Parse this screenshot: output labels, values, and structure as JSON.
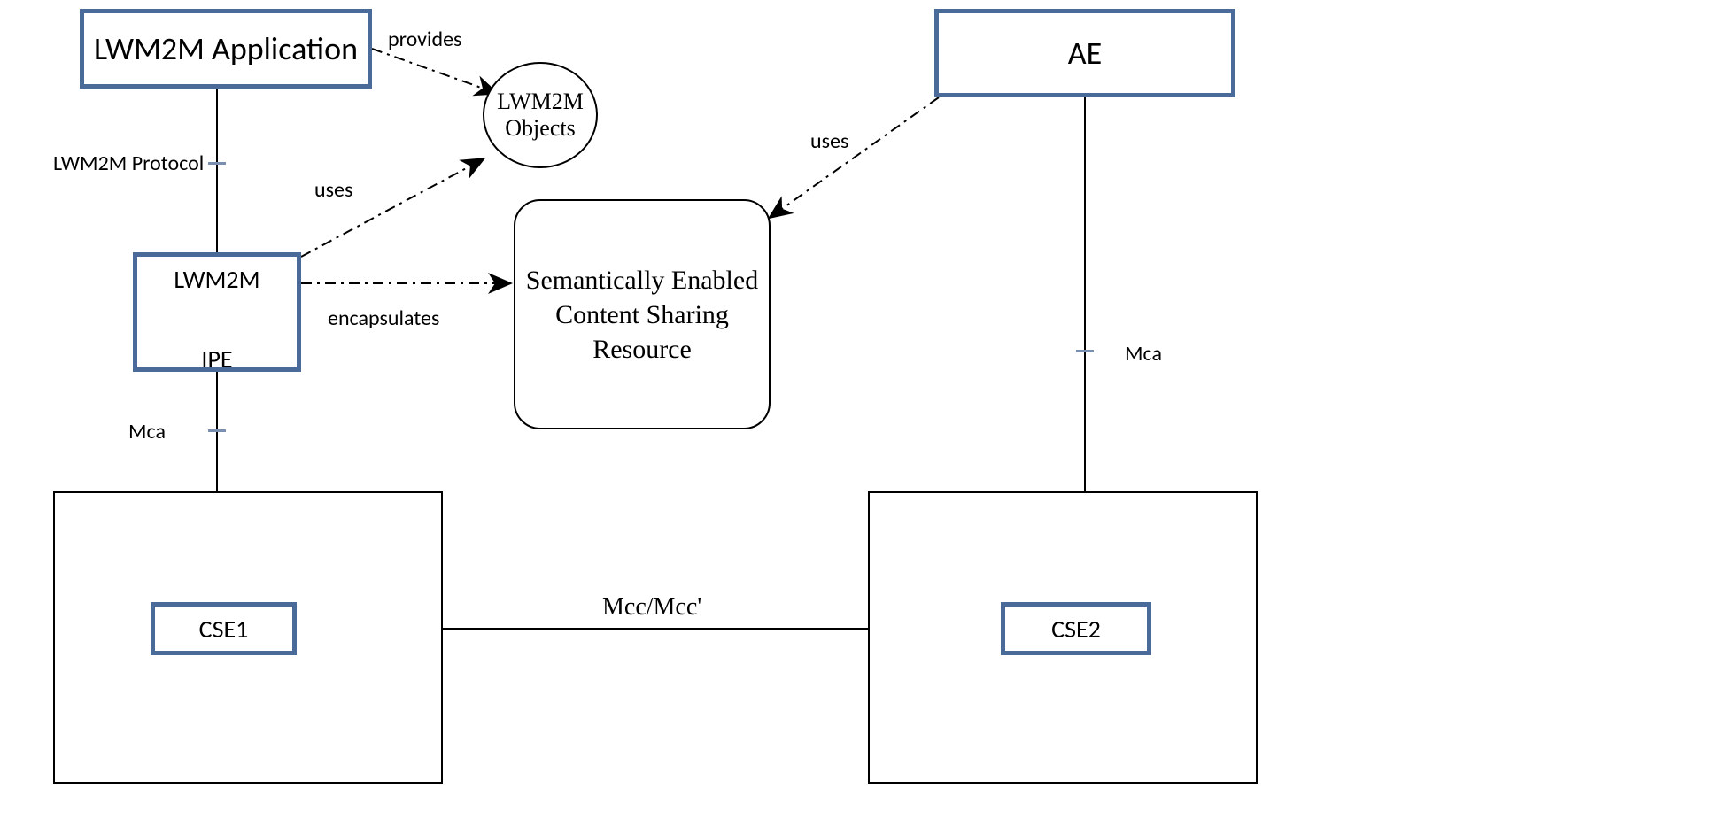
{
  "nodes": {
    "lwm2m_app": "LWM2M Application",
    "lwm2m_ipe_top": "LWM2M",
    "lwm2m_ipe_bottom": "IPE",
    "lwm2m_objects": "LWM2M Objects",
    "semantic_box": "Semantically Enabled Content Sharing Resource",
    "ae": "AE",
    "cse1": "CSE1",
    "cse2": "CSE2"
  },
  "edges": {
    "provides": "provides",
    "uses_left": "uses",
    "encapsulates": "encapsulates",
    "uses_right": "uses",
    "lwm2m_protocol": "LWM2M Protocol",
    "mca_left": "Mca",
    "mca_right": "Mca",
    "mcc": "Mcc/Mcc'"
  }
}
